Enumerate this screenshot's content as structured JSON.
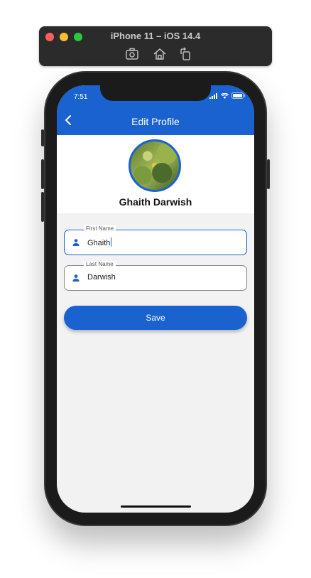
{
  "simulator": {
    "title": "iPhone 11 – iOS 14.4",
    "toolbar_icons": [
      "screenshot-icon",
      "home-icon",
      "rotate-icon"
    ]
  },
  "status_bar": {
    "time": "7:51",
    "icons": [
      "signal-icon",
      "wifi-icon",
      "battery-icon"
    ]
  },
  "header": {
    "title": "Edit Profile",
    "back_icon": "chevron-left-icon"
  },
  "profile": {
    "full_name": "Ghaith Darwish"
  },
  "form": {
    "first_name": {
      "label": "First Name",
      "value": "Ghaith",
      "icon": "person-icon"
    },
    "last_name": {
      "label": "Last Name",
      "value": "Darwish",
      "icon": "person-icon"
    },
    "save_label": "Save"
  },
  "colors": {
    "primary": "#1a62d0",
    "background": "#f2f2f2"
  }
}
